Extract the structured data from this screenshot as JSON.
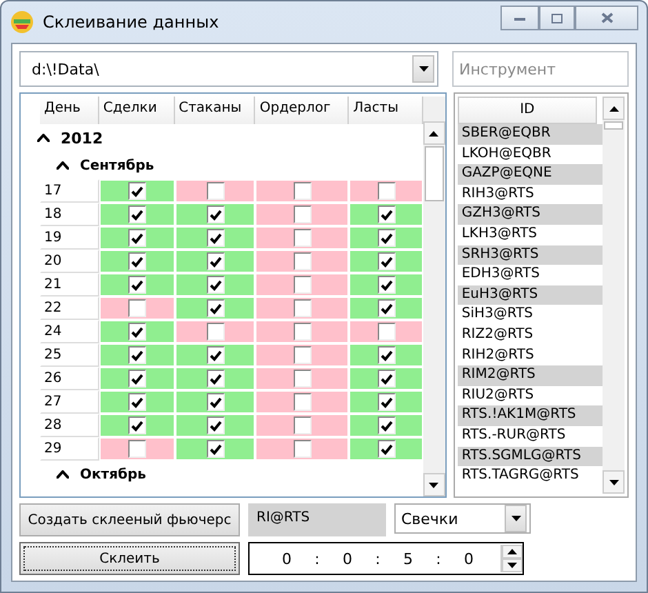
{
  "window": {
    "title": "Склеивание данных"
  },
  "path": {
    "value": "d:\\!Data\\"
  },
  "instrument": {
    "placeholder": "Инструмент"
  },
  "grid": {
    "columns": [
      "День",
      "Сделки",
      "Стаканы",
      "Ордерлог",
      "Ласты"
    ],
    "groups": [
      {
        "label": "2012",
        "expanded": true,
        "children": [
          {
            "label": "Сентябрь",
            "expanded": true,
            "rows": [
              {
                "day": "17",
                "cells": [
                  true,
                  false,
                  false,
                  false
                ]
              },
              {
                "day": "18",
                "cells": [
                  true,
                  true,
                  false,
                  true
                ]
              },
              {
                "day": "19",
                "cells": [
                  true,
                  true,
                  false,
                  true
                ]
              },
              {
                "day": "20",
                "cells": [
                  true,
                  true,
                  false,
                  true
                ]
              },
              {
                "day": "21",
                "cells": [
                  true,
                  true,
                  false,
                  true
                ]
              },
              {
                "day": "22",
                "cells": [
                  false,
                  true,
                  false,
                  true
                ]
              },
              {
                "day": "24",
                "cells": [
                  true,
                  false,
                  false,
                  false
                ]
              },
              {
                "day": "25",
                "cells": [
                  true,
                  true,
                  false,
                  true
                ]
              },
              {
                "day": "26",
                "cells": [
                  true,
                  true,
                  false,
                  true
                ]
              },
              {
                "day": "27",
                "cells": [
                  true,
                  true,
                  false,
                  true
                ]
              },
              {
                "day": "28",
                "cells": [
                  true,
                  true,
                  false,
                  true
                ]
              },
              {
                "day": "29",
                "cells": [
                  false,
                  true,
                  false,
                  true
                ]
              }
            ]
          },
          {
            "label": "Октябрь",
            "expanded": true
          }
        ]
      }
    ]
  },
  "ids": {
    "column": "ID",
    "items": [
      {
        "label": "SBER@EQBR",
        "selected": true
      },
      {
        "label": "LKOH@EQBR",
        "selected": false
      },
      {
        "label": "GAZP@EQNE",
        "selected": true
      },
      {
        "label": "RIH3@RTS",
        "selected": false
      },
      {
        "label": "GZH3@RTS",
        "selected": true
      },
      {
        "label": "LKH3@RTS",
        "selected": false
      },
      {
        "label": "SRH3@RTS",
        "selected": true
      },
      {
        "label": "EDH3@RTS",
        "selected": false
      },
      {
        "label": "EuH3@RTS",
        "selected": true
      },
      {
        "label": "SiH3@RTS",
        "selected": false
      },
      {
        "label": "RIZ2@RTS",
        "selected": false
      },
      {
        "label": "RIH2@RTS",
        "selected": false
      },
      {
        "label": "RIM2@RTS",
        "selected": true
      },
      {
        "label": "RIU2@RTS",
        "selected": false
      },
      {
        "label": "RTS.!AK1M@RTS",
        "selected": true
      },
      {
        "label": "RTS.-RUR@RTS",
        "selected": false
      },
      {
        "label": "RTS.SGMLG@RTS",
        "selected": true
      },
      {
        "label": "RTS.TAGRG@RTS",
        "selected": false
      }
    ]
  },
  "create_button": "Создать склееный фьючерс",
  "future_name": "RI@RTS",
  "type_select": {
    "value": "Свечки"
  },
  "glue_button": "Склеить",
  "timeframe": {
    "parts": [
      "0",
      "0",
      "5",
      "0"
    ],
    "separator": ":"
  }
}
